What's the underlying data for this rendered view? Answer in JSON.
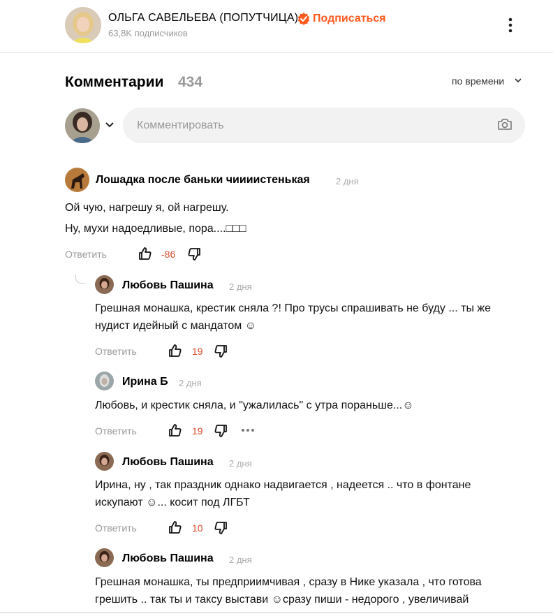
{
  "header": {
    "channel_name": "ОЛЬГА САВЕЛЬЕВА (ПОПУТЧИЦА)",
    "subscribe_label": "Подписаться",
    "subscribers": "63,8K подписчиков",
    "verified_icon": "verified-check-icon",
    "more_icon": "vertical-dots-icon"
  },
  "comments_section": {
    "title": "Комментарии",
    "count": "434",
    "sort_label": "по времени",
    "input_placeholder": "Комментировать",
    "camera_icon": "camera-icon"
  },
  "colors": {
    "accent": "#ff5a1f",
    "score": "#e04a2a",
    "muted": "#999999"
  },
  "comments": [
    {
      "author": "Лошадка после баньки чиииистенькая",
      "date": "2 дня",
      "lines": [
        "Ой чую, нагрешу я, ой нагрешу.",
        "Ну, мухи надоедливые, пора....□□□"
      ],
      "reply_label": "Ответить",
      "score": "-86"
    },
    {
      "author": "Любовь Пашина",
      "date": "2 дня",
      "lines": [
        "Грешная монашка, крестик сняла ?! Про трусы спрашивать не буду ... ты же",
        "нудист идейный с мандатом ☺"
      ],
      "reply_label": "Ответить",
      "score": "19"
    },
    {
      "author": "Ирина Б",
      "date": "2 дня",
      "lines": [
        "Любовь, и крестик сняла, и \"ужалилась\" с утра пораньше...☺"
      ],
      "reply_label": "Ответить",
      "score": "19"
    },
    {
      "author": "Любовь Пашина",
      "date": "2 дня",
      "lines": [
        "Ирина, ну , так праздник однако надвигается , надеется .. что в фонтане",
        "искупают ☺... косит под ЛГБТ"
      ],
      "reply_label": "Ответить",
      "score": "10"
    },
    {
      "author": "Любовь Пашина",
      "date": "2 дня",
      "lines": [
        "Грешная монашка, ты предприимчивая , сразу в Нике указала , что готова",
        "грешить .. так ты и таксу выстави ☺сразу пиши - недорого , увеличивай"
      ]
    }
  ]
}
